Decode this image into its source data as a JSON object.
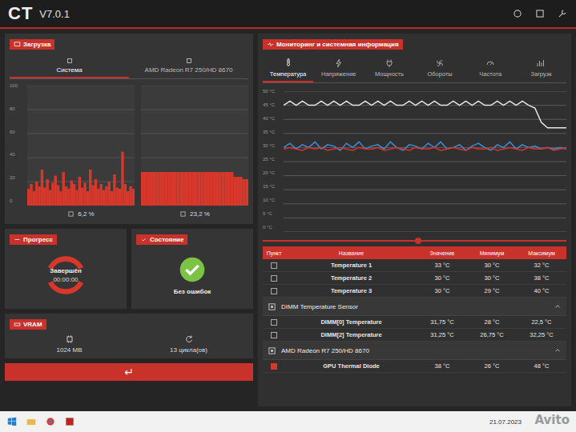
{
  "app": {
    "logo": "CT",
    "version": "V7.0.1"
  },
  "load_panel": {
    "title": "Загрузка",
    "tabs": [
      {
        "label": "Система",
        "selected": true
      },
      {
        "label": "AMD Radeon R7 250/HD 8670",
        "selected": false
      }
    ],
    "y_ticks": [
      "100",
      "80",
      "60",
      "40",
      "20",
      "0"
    ],
    "charts": [
      {
        "values": [
          14,
          18,
          12,
          20,
          16,
          30,
          15,
          22,
          13,
          19,
          25,
          17,
          12,
          28,
          16,
          14,
          21,
          18,
          13,
          24,
          15,
          19,
          12,
          30,
          17,
          22,
          14,
          18,
          13,
          16,
          20,
          12,
          26,
          15,
          14,
          45,
          18,
          12,
          16,
          14
        ],
        "reading": "6,2 %"
      },
      {
        "values": [
          28,
          28,
          28,
          28,
          28,
          28,
          28,
          28,
          28,
          28,
          28,
          28,
          28,
          28,
          28,
          28,
          28,
          28,
          28,
          28,
          28,
          28,
          28,
          28,
          28,
          28,
          28,
          28,
          28,
          28,
          28,
          24,
          24,
          24,
          22,
          22
        ],
        "reading": "23,2 %"
      }
    ]
  },
  "progress": {
    "title": "Прогресс",
    "status": "Завершён",
    "time": "00:00:00"
  },
  "state": {
    "title": "Состояние",
    "status": "Без ошибок"
  },
  "vram": {
    "title": "VRAM",
    "memory": "1024 MB",
    "cycles": "13 цикла(ов)"
  },
  "back_button": "↵",
  "monitor": {
    "title": "Мониторинг и системная информация",
    "tabs": [
      {
        "label": "Температура",
        "selected": true
      },
      {
        "label": "Напряжение",
        "selected": false
      },
      {
        "label": "Мощность",
        "selected": false
      },
      {
        "label": "Обороты",
        "selected": false
      },
      {
        "label": "Частота",
        "selected": false
      },
      {
        "label": "Загрузк",
        "selected": false
      }
    ],
    "y_ticks": [
      "50 °C",
      "45 °C",
      "40 °C",
      "35 °C",
      "30 °C",
      "25 °C",
      "20 °C",
      "15 °C",
      "10 °C",
      "5 °C",
      "0 °C"
    ],
    "series": [
      {
        "color": "#e6e6e6",
        "values": [
          45,
          46.5,
          45,
          46.5,
          45,
          45,
          46.5,
          45,
          46.5,
          45,
          46.5,
          45,
          45,
          46.5,
          45,
          46.5,
          45,
          46.5,
          45,
          45,
          46.5,
          45,
          46.5,
          45,
          46.5,
          45,
          45,
          46.5,
          45,
          46.5,
          45,
          46.5,
          45,
          45,
          46.5,
          45,
          46.5,
          45,
          46.5,
          45,
          44,
          39,
          37,
          37,
          37,
          37
        ]
      },
      {
        "color": "#3a8fd8",
        "values": [
          30,
          31.5,
          29.5,
          31,
          30,
          32,
          29.5,
          31,
          30.5,
          29,
          31.5,
          30,
          32,
          29.5,
          30.5,
          31,
          29.5,
          32,
          30,
          29,
          31,
          30.5,
          29.5,
          31.5,
          30,
          32,
          29.5,
          30,
          31,
          29,
          30.5,
          31.5,
          30,
          29,
          31,
          30,
          32,
          29.5,
          31,
          30,
          30.5,
          29.5,
          30,
          29.5,
          30,
          29.5
        ]
      },
      {
        "color": "#d8332a",
        "values": [
          29.5,
          30,
          29.5,
          29,
          30,
          29.5,
          30,
          29,
          29.5,
          30,
          29.5,
          29,
          30,
          29.5,
          29.5,
          30,
          29,
          29.5,
          30,
          29.5,
          29,
          30,
          29.5,
          29.5,
          30,
          29,
          29.5,
          30,
          29.5,
          29,
          30,
          29.5,
          29.5,
          30,
          29,
          29.5,
          30,
          29.5,
          29,
          30,
          29.5,
          29.5,
          30,
          29,
          29.5,
          30
        ]
      }
    ]
  },
  "table": {
    "columns": [
      "Пункт",
      "Название",
      "Значение",
      "Минимум",
      "Максимум"
    ],
    "rows": [
      {
        "kind": "sensor",
        "checked": false,
        "name": "Temperature 1",
        "value": "33 °C",
        "min": "30 °C",
        "max": "32 °C"
      },
      {
        "kind": "sensor",
        "checked": false,
        "name": "Temperature 2",
        "value": "30 °C",
        "min": "30 °C",
        "max": "38 °C"
      },
      {
        "kind": "sensor",
        "checked": false,
        "name": "Temperature 3",
        "value": "30 °C",
        "min": "29 °C",
        "max": "40 °C"
      },
      {
        "kind": "group",
        "expanded": true,
        "name": "DIMM Temperature Sensor"
      },
      {
        "kind": "sensor",
        "checked": false,
        "name": "DIMM[0] Temperature",
        "value": "31,75 °C",
        "min": "28 °C",
        "max": "22,5 °C"
      },
      {
        "kind": "sensor",
        "checked": false,
        "name": "DIMM[2] Temperature",
        "value": "31,25 °C",
        "min": "26,75 °C",
        "max": "32,25 °C"
      },
      {
        "kind": "group",
        "expanded": true,
        "name": "AMD Radeon R7 250/HD 8670"
      },
      {
        "kind": "sensor",
        "checked": true,
        "name": "GPU Thermal Diode",
        "value": "38 °C",
        "min": "26 °C",
        "max": "48 °C"
      }
    ]
  },
  "taskbar": {
    "clock": "21.07.2023"
  },
  "watermark": "Avito"
}
